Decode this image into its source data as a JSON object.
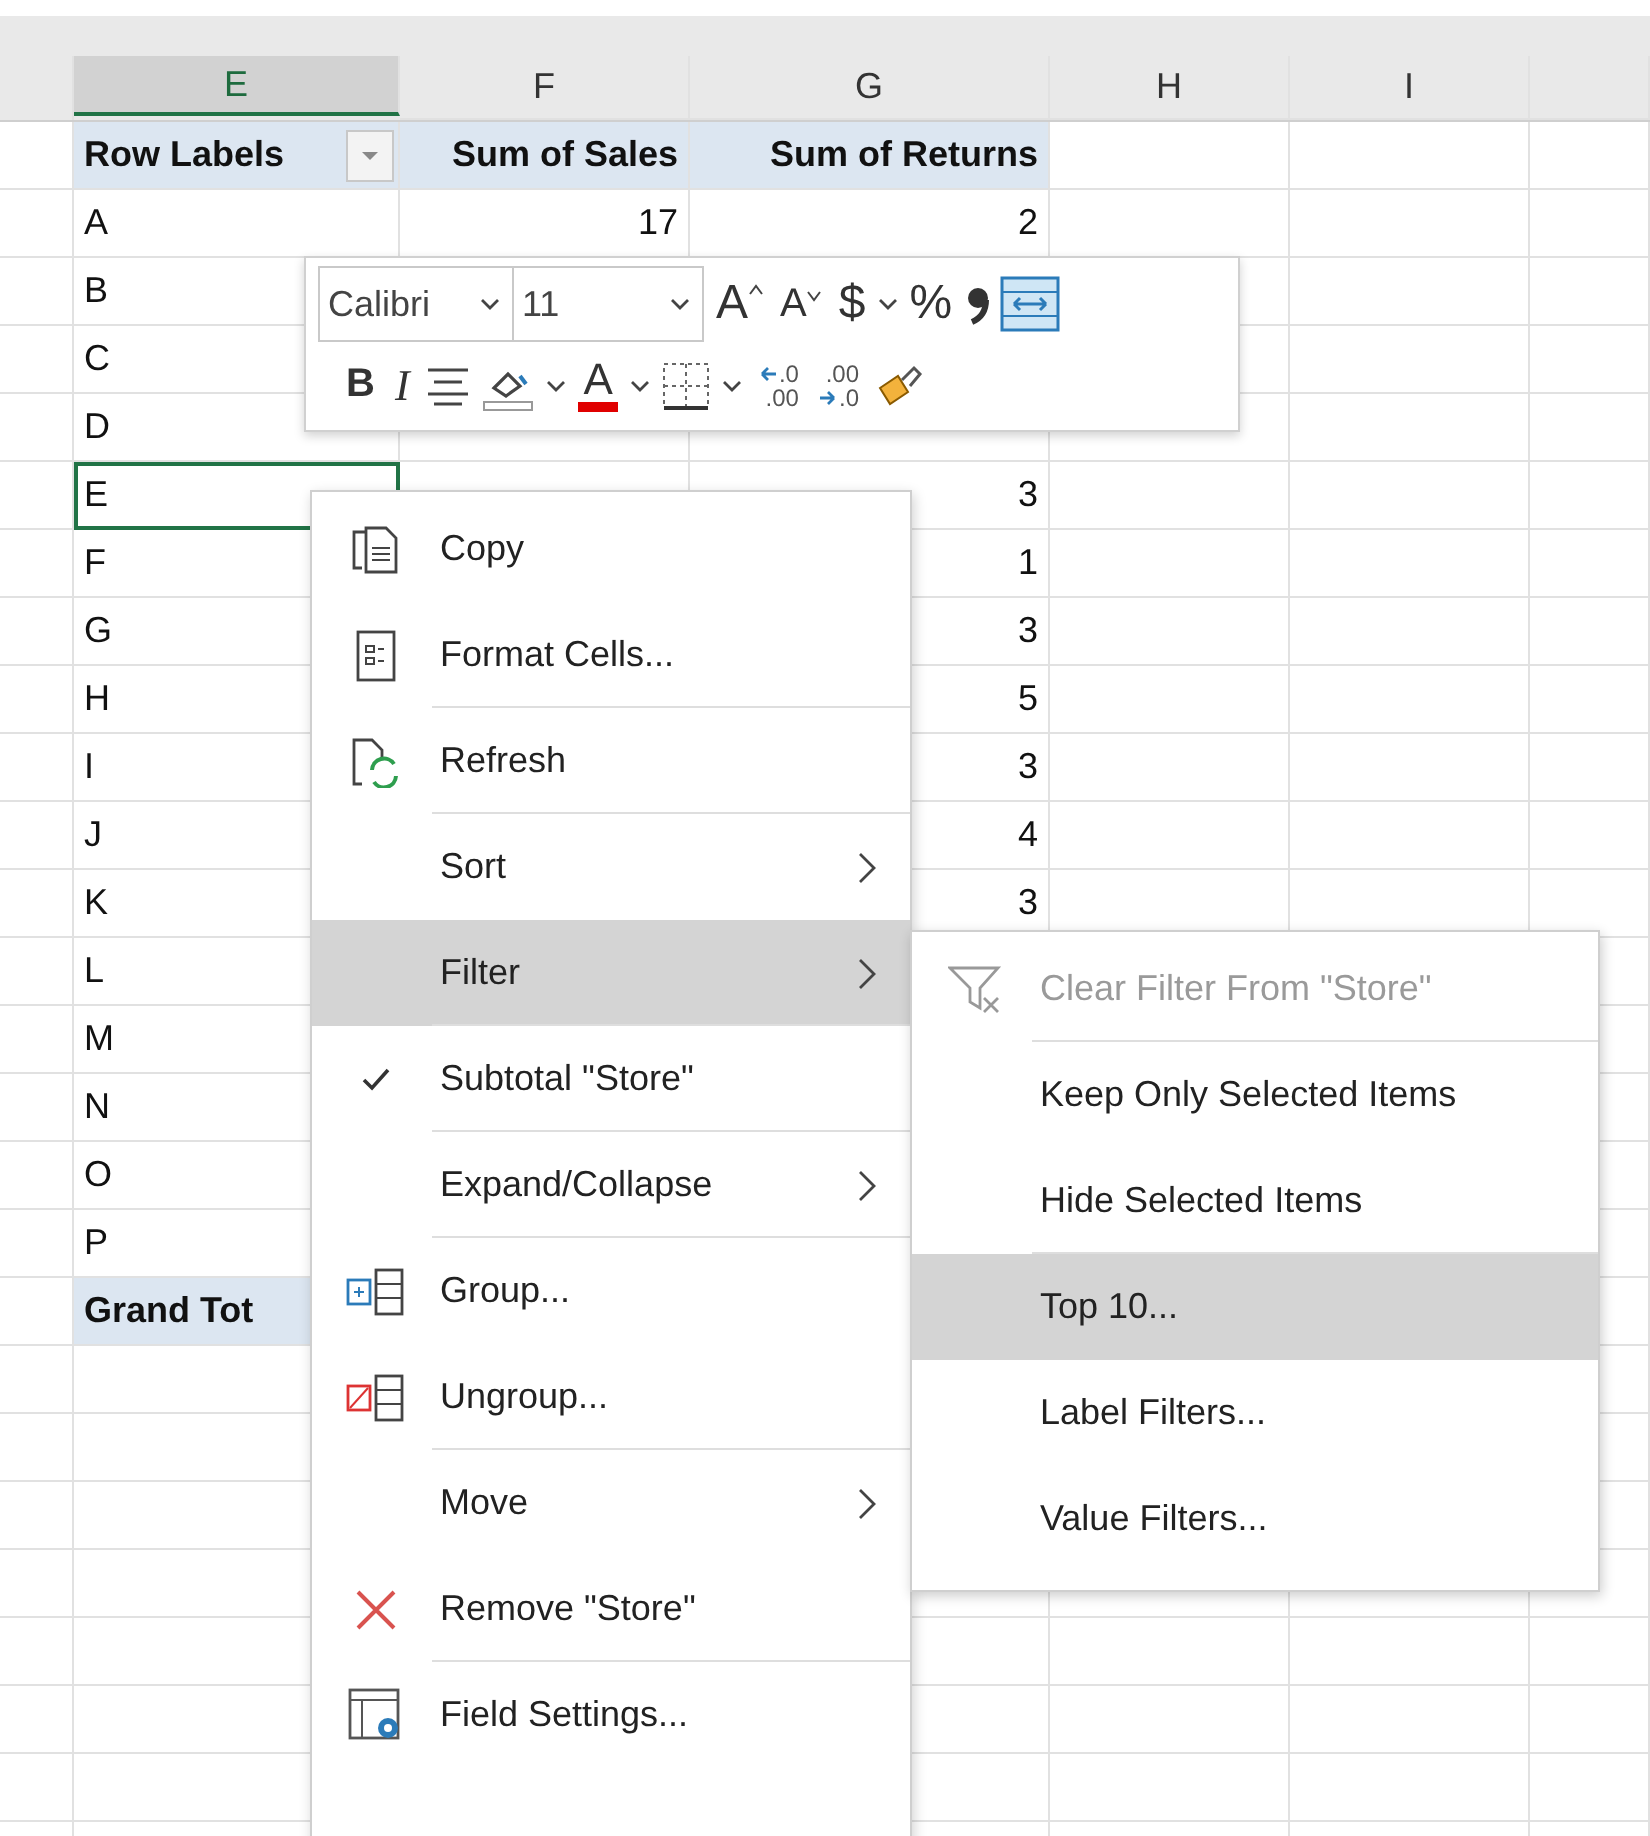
{
  "columns": [
    {
      "label": "E",
      "selected": true
    },
    {
      "label": "F",
      "selected": false
    },
    {
      "label": "G",
      "selected": false
    },
    {
      "label": "H",
      "selected": false
    },
    {
      "label": "I",
      "selected": false
    }
  ],
  "pivot": {
    "header": {
      "row_labels": "Row Labels",
      "sales": "Sum of Sales",
      "returns": "Sum of Returns"
    },
    "rows": [
      {
        "label": "A",
        "sales": "17",
        "returns": "2",
        "selected": false
      },
      {
        "label": "B",
        "selected": false
      },
      {
        "label": "C",
        "selected": false
      },
      {
        "label": "D",
        "selected": false
      },
      {
        "label": "E",
        "returns": "3",
        "selected": true
      },
      {
        "label": "F",
        "returns": "1",
        "selected": false
      },
      {
        "label": "G",
        "returns": "3",
        "selected": false
      },
      {
        "label": "H",
        "returns": "5",
        "selected": false
      },
      {
        "label": "I",
        "returns": "3",
        "selected": false
      },
      {
        "label": "J",
        "returns": "4",
        "selected": false
      },
      {
        "label": "K",
        "returns": "3",
        "selected": false
      },
      {
        "label": "L",
        "selected": false
      },
      {
        "label": "M",
        "selected": false
      },
      {
        "label": "N",
        "selected": false
      },
      {
        "label": "O",
        "selected": false
      },
      {
        "label": "P",
        "selected": false
      }
    ],
    "grand_total": {
      "label": "Grand Tot"
    }
  },
  "mini_toolbar": {
    "font": "Calibri",
    "size": "11",
    "grow_font": "A",
    "shrink_font": "A",
    "currency": "$",
    "percent": "%",
    "bold": "B",
    "italic": "I",
    "font_color": "A",
    "increase_decimal": [
      ".0",
      ".00"
    ],
    "decrease_decimal": [
      ".00",
      ".0"
    ]
  },
  "context_menu": {
    "items": [
      {
        "kind": "copy",
        "label": "Copy",
        "submenu": false,
        "checked": false,
        "selected": false,
        "divider": false
      },
      {
        "kind": "format",
        "label": "Format Cells...",
        "submenu": false,
        "checked": false,
        "selected": false,
        "divider": true
      },
      {
        "kind": "refresh",
        "label": "Refresh",
        "submenu": false,
        "checked": false,
        "selected": false,
        "divider": true
      },
      {
        "kind": "plain",
        "label": "Sort",
        "submenu": true,
        "checked": false,
        "selected": false,
        "divider": false
      },
      {
        "kind": "plain",
        "label": "Filter",
        "submenu": true,
        "checked": false,
        "selected": true,
        "divider": true
      },
      {
        "kind": "plain",
        "label": "Subtotal \"Store\"",
        "submenu": false,
        "checked": true,
        "selected": false,
        "divider": true
      },
      {
        "kind": "plain",
        "label": "Expand/Collapse",
        "submenu": true,
        "checked": false,
        "selected": false,
        "divider": true
      },
      {
        "kind": "group",
        "label": "Group...",
        "submenu": false,
        "checked": false,
        "selected": false,
        "divider": false
      },
      {
        "kind": "ungroup",
        "label": "Ungroup...",
        "submenu": false,
        "checked": false,
        "selected": false,
        "divider": true
      },
      {
        "kind": "plain",
        "label": "Move",
        "submenu": true,
        "checked": false,
        "selected": false,
        "divider": false
      },
      {
        "kind": "remove",
        "label": "Remove \"Store\"",
        "submenu": false,
        "checked": false,
        "selected": false,
        "divider": true
      },
      {
        "kind": "settings",
        "label": "Field Settings...",
        "submenu": false,
        "checked": false,
        "selected": false,
        "divider": false
      }
    ]
  },
  "filter_submenu": {
    "items": [
      {
        "kind": "clear",
        "label": "Clear Filter From \"Store\"",
        "disabled": true,
        "selected": false,
        "divider": true
      },
      {
        "kind": "plain",
        "label": "Keep Only Selected Items",
        "disabled": false,
        "selected": false,
        "divider": false
      },
      {
        "kind": "plain",
        "label": "Hide Selected Items",
        "disabled": false,
        "selected": false,
        "divider": true
      },
      {
        "kind": "plain",
        "label": "Top 10...",
        "disabled": false,
        "selected": true,
        "divider": false
      },
      {
        "kind": "plain",
        "label": "Label Filters...",
        "disabled": false,
        "selected": false,
        "divider": false
      },
      {
        "kind": "plain",
        "label": "Value Filters...",
        "disabled": false,
        "selected": false,
        "divider": false
      }
    ]
  }
}
